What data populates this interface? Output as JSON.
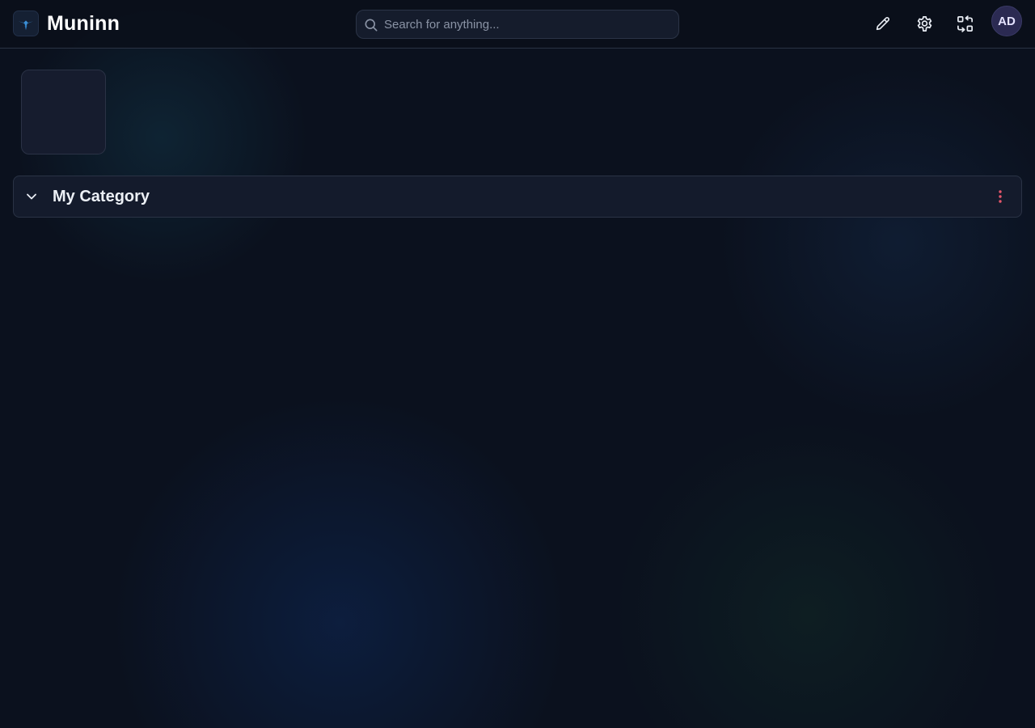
{
  "header": {
    "app_title": "Muninn",
    "logo_icon": "bird-logo-icon",
    "search": {
      "placeholder": "Search for anything...",
      "value": ""
    },
    "actions": [
      {
        "icon": "pencil-icon"
      },
      {
        "icon": "gear-icon"
      },
      {
        "icon": "swap-icon"
      }
    ],
    "avatar_initials": "AD"
  },
  "main": {
    "category": {
      "title": "My Category",
      "expanded": true,
      "menu_icon": "kebab-menu-icon"
    }
  },
  "colors": {
    "background": "#0b111e",
    "accent_logo": "#3b8fd6",
    "kebab": "#e5566b",
    "avatar_bg": "#2b2a52"
  }
}
